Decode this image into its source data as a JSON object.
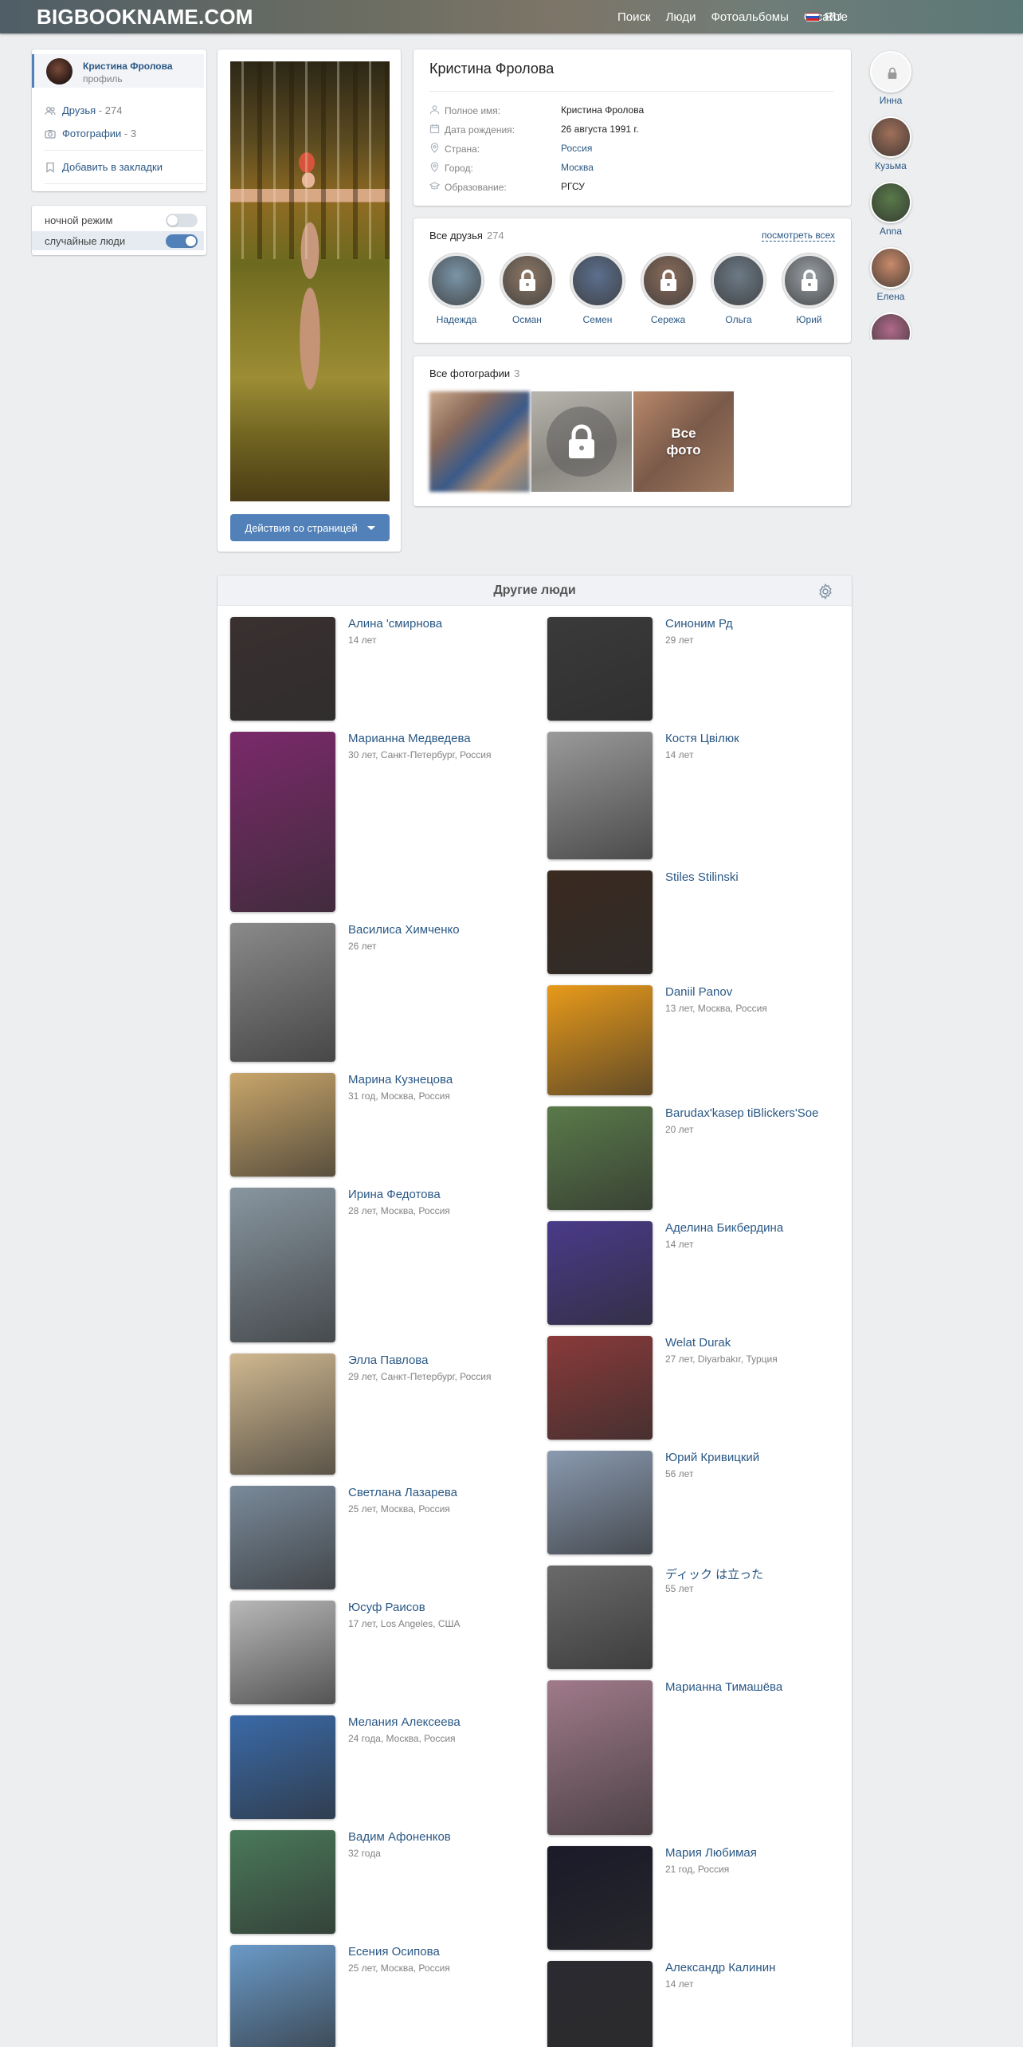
{
  "header": {
    "logo": "BIGBOOKNAME.COM",
    "nav": [
      "Поиск",
      "Люди",
      "Фотоальбомы",
      "О сайте"
    ],
    "lang": "RU"
  },
  "left_menu": {
    "user_name": "Кристина Фролова",
    "user_sub": "профиль",
    "friends_label": "Друзья",
    "friends_count": "- 274",
    "photos_label": "Фотографии",
    "photos_count": "- 3",
    "bookmark_label": "Добавить в закладки",
    "night_mode_label": "ночной режим",
    "night_mode_on": false,
    "random_people_label": "случайные люди",
    "random_people_on": true
  },
  "profile": {
    "name": "Кристина Фролова",
    "actions_label": "Действия со страницей",
    "fields": [
      {
        "label": "Полное имя:",
        "value": "Кристина Фролова",
        "icon": "user-icon",
        "link": false
      },
      {
        "label": "Дата рождения:",
        "value": "26 августа 1991 г.",
        "icon": "calendar-icon",
        "link": false
      },
      {
        "label": "Страна:",
        "value": "Россия",
        "icon": "location-icon",
        "link": true
      },
      {
        "label": "Город:",
        "value": "Москва",
        "icon": "location-icon",
        "link": true
      },
      {
        "label": "Образование:",
        "value": "РГСУ",
        "icon": "graduation-cap-icon",
        "link": false
      }
    ]
  },
  "friends_block": {
    "title": "Все друзья",
    "count": "274",
    "see_all": "посмотреть всех",
    "friends": [
      {
        "name": "Надежда",
        "locked": false,
        "color": "#7a95a8"
      },
      {
        "name": "Осман",
        "locked": true,
        "color": "#8c7766"
      },
      {
        "name": "Семен",
        "locked": false,
        "color": "#5b6f8e"
      },
      {
        "name": "Сережа",
        "locked": true,
        "color": "#8a6b5a"
      },
      {
        "name": "Ольга",
        "locked": false,
        "color": "#6c7a86"
      },
      {
        "name": "Юрий",
        "locked": true,
        "color": "#9aa0a6"
      }
    ]
  },
  "photos_block": {
    "title": "Все фотографии",
    "count": "3",
    "all_photos_label": "Все фото"
  },
  "right_rail": [
    {
      "name": "Инна",
      "color": "#f2f2f2"
    },
    {
      "name": "Кузьма",
      "color": "#a0705a"
    },
    {
      "name": "Anna",
      "color": "#5a7a4a"
    },
    {
      "name": "Елена",
      "color": "#c98a6a"
    }
  ],
  "others": {
    "title": "Другие люди",
    "left": [
      {
        "name": "Алина 'смирнова",
        "info": "14 лет",
        "color": "#3a3030"
      },
      {
        "name": "Марианна Медведева",
        "info": "30 лет, Санкт-Петербург, Россия",
        "color": "#7a2a6a"
      },
      {
        "name": "Василиса Химченко",
        "info": "26 лет",
        "color": "#8a8a8a"
      },
      {
        "name": "Марина Кузнецова",
        "info": "31 год, Москва, Россия",
        "color": "#c9a66a"
      },
      {
        "name": "Ирина Федотова",
        "info": "28 лет, Москва, Россия",
        "color": "#8896a0"
      },
      {
        "name": "Элла Павлова",
        "info": "29 лет, Санкт-Петербург, Россия",
        "color": "#d0b890"
      },
      {
        "name": "Светлана Лазарева",
        "info": "25 лет, Москва, Россия",
        "color": "#7a8a9a"
      },
      {
        "name": "Юсуф Раисов",
        "info": "17 лет, Los Angeles, США",
        "color": "#b8b8b8"
      },
      {
        "name": "Мелания Алексеева",
        "info": "24 года, Москва, Россия",
        "color": "#3a6aa8"
      },
      {
        "name": "Вадим Афоненков",
        "info": "32 года",
        "color": "#4a7a5a"
      },
      {
        "name": "Есения Осипова",
        "info": "25 лет, Москва, Россия",
        "color": "#6a9ac8"
      }
    ],
    "right": [
      {
        "name": "Синоним Рд",
        "info": "29 лет",
        "color": "#3a3a3a"
      },
      {
        "name": "Костя Цвілюк",
        "info": "14 лет",
        "color": "#9a9a9a"
      },
      {
        "name": "Stiles Stilinski",
        "info": "",
        "color": "#3a2a20"
      },
      {
        "name": "Daniil Panov",
        "info": "13 лет, Москва, Россия",
        "color": "#e89a1a"
      },
      {
        "name": "Barudax'kasep tiBlickers'Soe",
        "info": "20 лет",
        "color": "#5a7a4a"
      },
      {
        "name": "Аделина Бикбердина",
        "info": "14 лет",
        "color": "#4a3a8a"
      },
      {
        "name": "Welat Durak",
        "info": "27 лет, Diyarbakır, Турция",
        "color": "#8a3a3a"
      },
      {
        "name": "Юрий Кривицкий",
        "info": "56 лет",
        "color": "#8a9ab0"
      },
      {
        "name": "ディック は立った",
        "info": "55 лет",
        "color": "#6a6a6a"
      },
      {
        "name": "Марианна Тимашёва",
        "info": "",
        "color": "#a07a8a"
      },
      {
        "name": "Мария Любимая",
        "info": "21 год, Россия",
        "color": "#1a1a2a"
      },
      {
        "name": "Александр Калинин",
        "info": "14 лет",
        "color": "#2a2a30"
      }
    ]
  }
}
